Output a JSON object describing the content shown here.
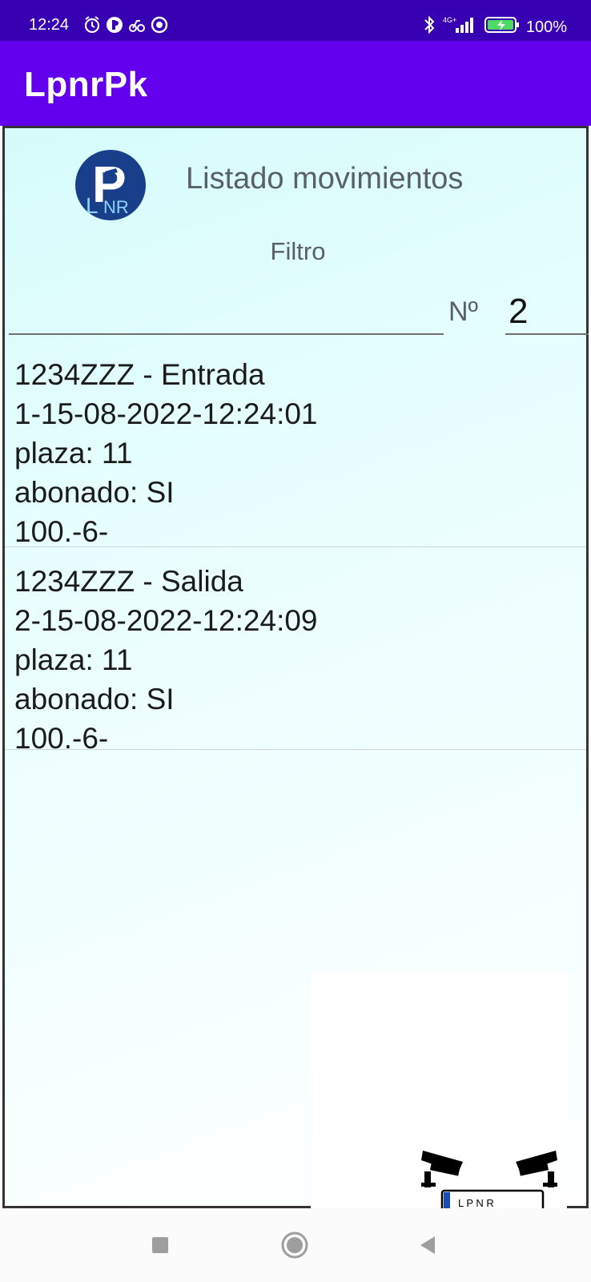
{
  "status_bar": {
    "time": "12:24",
    "network": "4G+",
    "battery": "100%"
  },
  "app_bar": {
    "title": "LpnrPk"
  },
  "screen": {
    "title": "Listado movimientos",
    "filter_label": "Filtro",
    "filter_value": "",
    "number_label": "Nº",
    "number_value": "2"
  },
  "movements": [
    {
      "header": "1234ZZZ - Entrada",
      "timestamp": "1-15-08-2022-12:24:01",
      "plaza": "plaza: 11",
      "abonado": "abonado: SI",
      "code": "100.-6-"
    },
    {
      "header": "1234ZZZ - Salida",
      "timestamp": "2-15-08-2022-12:24:09",
      "plaza": "plaza: 11",
      "abonado": "abonado: SI",
      "code": "100.-6-"
    }
  ],
  "logo": {
    "letters": "LPNR"
  },
  "illustration": {
    "plate_text": "L P N R"
  },
  "colors": {
    "status_bar": "#3700b3",
    "app_bar": "#6200ee",
    "logo_bg": "#1a3f8a"
  }
}
